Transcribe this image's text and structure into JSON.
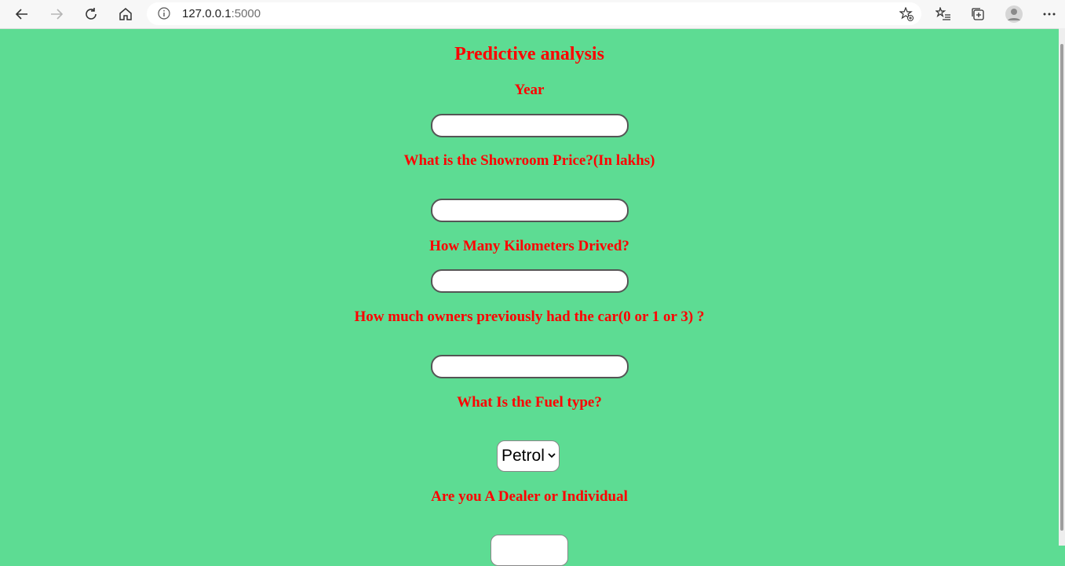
{
  "browser": {
    "url_host": "127.0.0.1",
    "url_port": ":5000"
  },
  "page": {
    "title": "Predictive analysis",
    "fields": {
      "year_label": "Year",
      "price_label": "What is the Showroom Price?(In lakhs)",
      "kms_label": "How Many Kilometers Drived?",
      "owners_label": "How much owners previously had the car(0 or 1 or 3) ?",
      "fuel_label": "What Is the Fuel type?",
      "fuel_selected": "Petrol",
      "seller_label": "Are you A Dealer or Individual"
    }
  }
}
